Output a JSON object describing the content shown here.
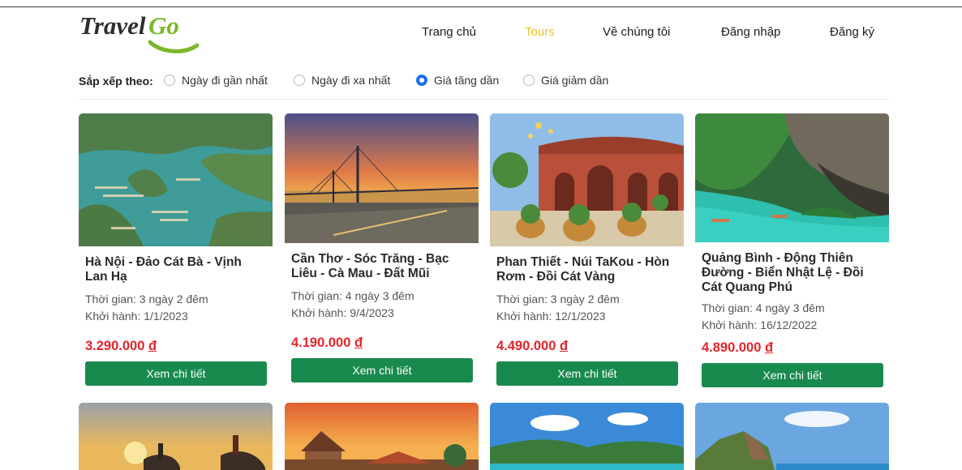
{
  "brand": {
    "logo_text_dark": "Travel",
    "logo_text_green": "Go"
  },
  "nav": {
    "home": "Trang chủ",
    "tours": "Tours",
    "about": "Về chúng tôi",
    "login": "Đăng nhập",
    "register": "Đăng ký",
    "active_color": "#f2c029"
  },
  "sort": {
    "label": "Sắp xếp theo:",
    "options": [
      "Ngày đi gần nhất",
      "Ngày đi xa nhất",
      "Giá tăng dần",
      "Giá giảm dần"
    ],
    "selected": "Giá tăng dần"
  },
  "button_color": "#198a4e",
  "price_color": "#e3252a",
  "tours": [
    {
      "title": "Hà Nội - Đảo Cát Bà - Vịnh Lan Hạ",
      "duration": "Thời gian: 3 ngày 2 đêm",
      "departure": "Khởi hành: 1/1/2023",
      "price": "3.290.000",
      "currency": "đ",
      "button": "Xem chi tiết"
    },
    {
      "title": "Cần Thơ - Sóc Trăng - Bạc Liêu - Cà Mau - Đất Mũi",
      "duration": "Thời gian: 4 ngày 3 đêm",
      "departure": "Khởi hành: 9/4/2023",
      "price": "4.190.000",
      "currency": "đ",
      "button": "Xem chi tiết"
    },
    {
      "title": "Phan Thiết - Núi TaKou - Hòn Rơm - Đồi Cát Vàng",
      "duration": "Thời gian: 3 ngày 2 đêm",
      "departure": "Khởi hành: 12/1/2023",
      "price": "4.490.000",
      "currency": "đ",
      "button": "Xem chi tiết"
    },
    {
      "title": "Quảng Bình - Động Thiên Đường - Biển Nhật Lệ - Đồi Cát Quang Phú",
      "duration": "Thời gian: 4 ngày 3 đêm",
      "departure": "Khởi hành: 16/12/2022",
      "price": "4.890.000",
      "currency": "đ",
      "button": "Xem chi tiết"
    }
  ]
}
